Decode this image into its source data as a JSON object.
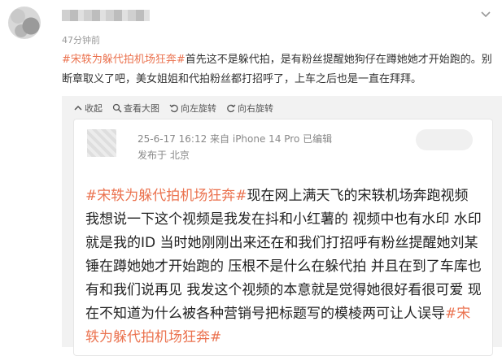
{
  "post": {
    "time": "47分钟前",
    "hashtag": "#宋轶为躲代拍机场狂奔#",
    "text": "首先这不是躲代拍，是有粉丝提醒她狗仔在蹲她她才开始跑的。别断章取义了吧，美女姐姐和代拍粉丝都打招呼了，上车之后也是一直在拜拜。"
  },
  "toolbar": {
    "collapse": "收起",
    "view_large": "查看大图",
    "rotate_left": "向左旋转",
    "rotate_right": "向右旋转"
  },
  "card": {
    "meta_line1": "25-6-17 16:12  来自 iPhone 14 Pro 已编辑",
    "meta_line2": "发布于 北京",
    "hashtag_start": "#宋轶为躲代拍机场狂奔#",
    "body": "现在网上满天飞的宋轶机场奔跑视频 我想说一下这个视频是我发在抖和小红薯的 视频中也有水印 水印就是我的ID 当时她刚刚出来还在和我们打招呼有粉丝提醒她刘某锤在蹲她她才开始跑的 压根不是什么在躲代拍 并且在到了车库也有和我们说再见 我发这个视频的本意就是觉得她很好看很可爱 现在不知道为什么被各种营销号把标题写的模棱两可让人误导",
    "hashtag_end": "#宋轶为躲代拍机场狂奔#"
  }
}
